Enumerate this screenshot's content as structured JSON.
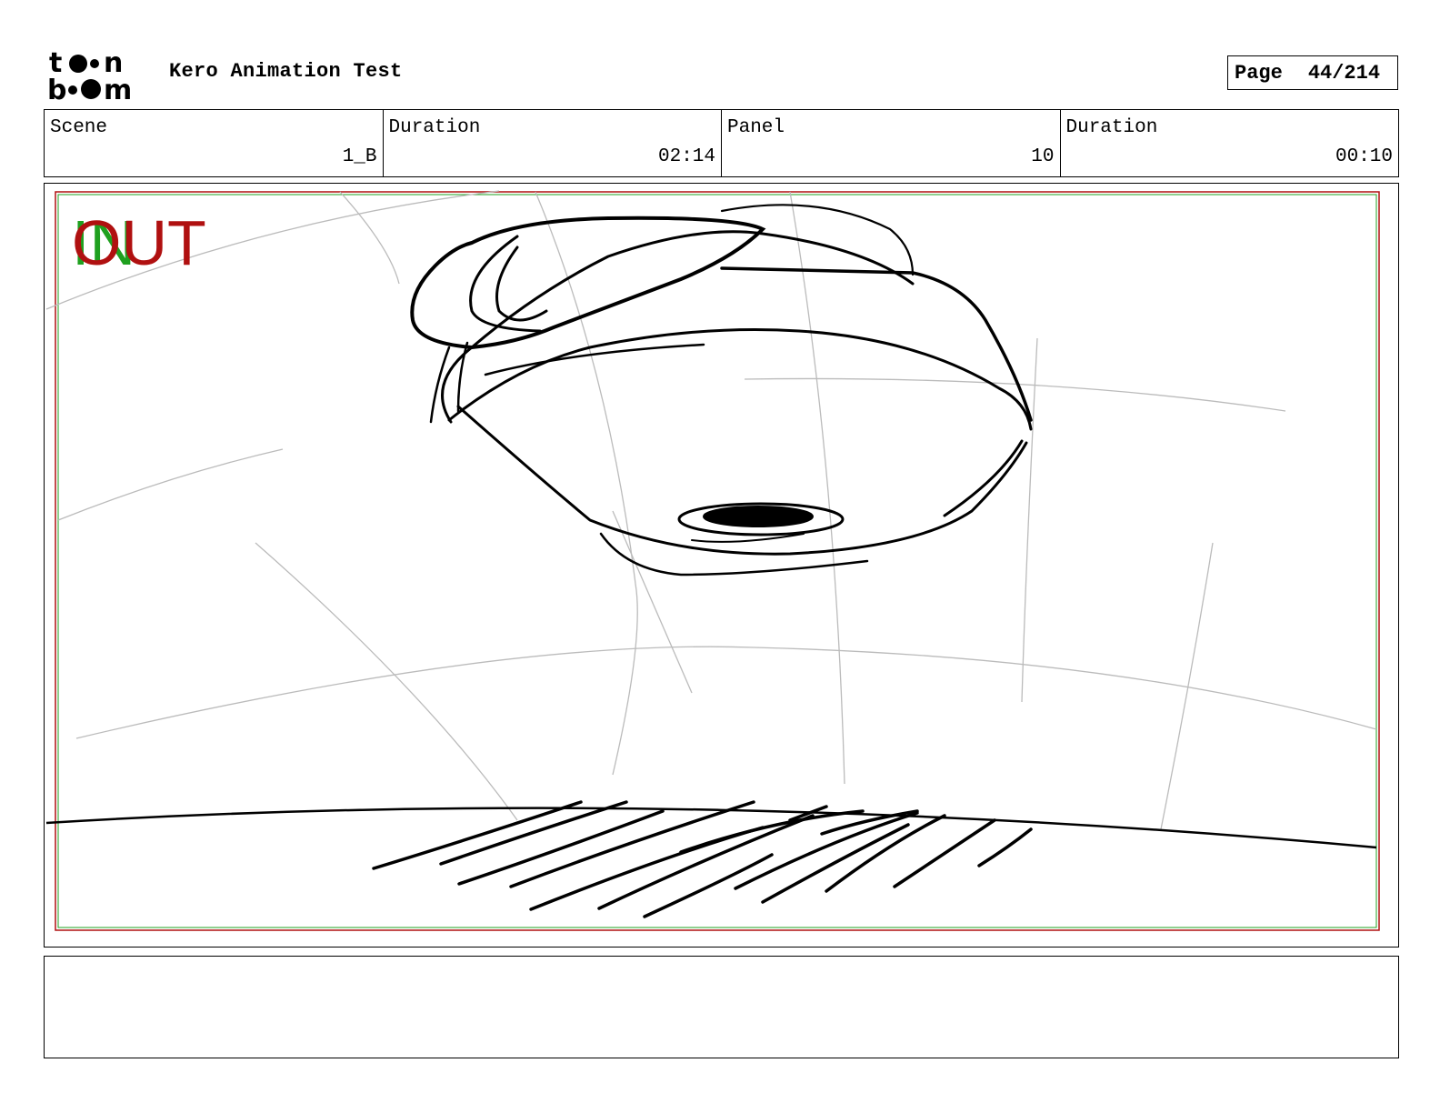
{
  "header": {
    "logo_text": "toon boom",
    "project_title": "Kero Animation Test",
    "page_label": "Page",
    "page_value": "44/214"
  },
  "info": {
    "scene_label": "Scene",
    "scene_value": "1_B",
    "scene_duration_label": "Duration",
    "scene_duration_value": "02:14",
    "panel_label": "Panel",
    "panel_value": "10",
    "panel_duration_label": "Duration",
    "panel_duration_value": "00:10"
  },
  "panel": {
    "in_mark": "IN",
    "out_mark": "OUT",
    "in_color": "#1fa01f",
    "out_color": "#b01010"
  },
  "notes": {
    "text": ""
  }
}
